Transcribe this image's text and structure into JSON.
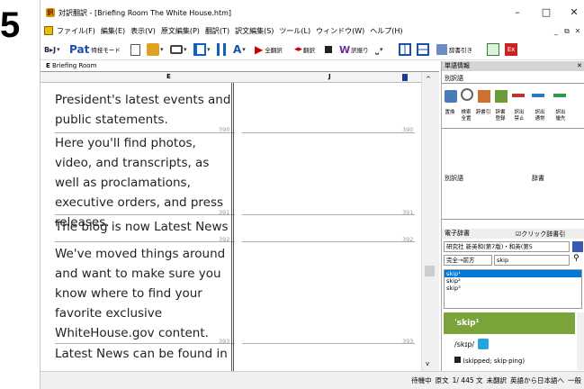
{
  "badge": "5",
  "window": {
    "title": "対訳翻訳 - [Briefing Room  The White House.htm]"
  },
  "menus": [
    "ファイル(F)",
    "編集(E)",
    "表示(V)",
    "原文編集(P)",
    "翻訳(T)",
    "訳文編集(S)",
    "ツール(L)",
    "ウィンドウ(W)",
    "ヘルプ(H)"
  ],
  "toolbar": {
    "br_label": "B▸J",
    "tokugi_label": "特技モード",
    "zenhonyaku": "全翻訳",
    "honyaku": "翻訳",
    "yakunuki": "訳振り",
    "jishobiki": "辞書引き"
  },
  "document": {
    "tab_label": "Briefing Room",
    "tab_prefix": "E",
    "col_e": "E",
    "col_j": "J",
    "segments": [
      {
        "text": "President's latest events and public statements.",
        "num": "390"
      },
      {
        "text": "Here you'll find photos, video, and transcripts, as well as proclamations, executive orders, and press releases.",
        "num": "391"
      },
      {
        "text": "The blog is now Latest News",
        "num": "392"
      },
      {
        "text": "We've moved things around and want to make sure you know where to find your favorite exclusive WhiteHouse.gov content.",
        "num": "393"
      },
      {
        "text": "Latest News can be found in",
        "num": ""
      }
    ]
  },
  "panel": {
    "header": "単語情報",
    "betsu_tab": "別訳語",
    "icons": [
      {
        "label": "置換"
      },
      {
        "label": "検索\n全置"
      },
      {
        "label": "辞書引"
      },
      {
        "label": "辞書\n登録"
      },
      {
        "label": "訳出\n禁止"
      },
      {
        "label": "訳出\n通常"
      },
      {
        "label": "訳出\n優先"
      }
    ],
    "col_betsu": "別訳語",
    "col_jisho": "辞書",
    "denshi_header": "電子辞書",
    "click_jisho": "クリック辞書引",
    "dict_select": "研究社 新英和(第7版)・和英(第5",
    "match_select": "完全→前方",
    "search_value": "skip",
    "results": [
      "skip¹",
      "skip²",
      "skip³"
    ],
    "entry_head": "ˈskip¹",
    "entry_pron": "/skɪp/",
    "entry_form": "(skipped; skip·ping)"
  },
  "status": {
    "state": "待機中",
    "genbun": "原文",
    "position": "1/ 445 文",
    "mihonyaku": "未翻訳",
    "direction": "英語から日本語へ",
    "mode": "一般"
  },
  "colors": {
    "accent_green": "#7aa33a",
    "select_blue": "#0078d7",
    "panel_header": "#d4d4d4"
  }
}
